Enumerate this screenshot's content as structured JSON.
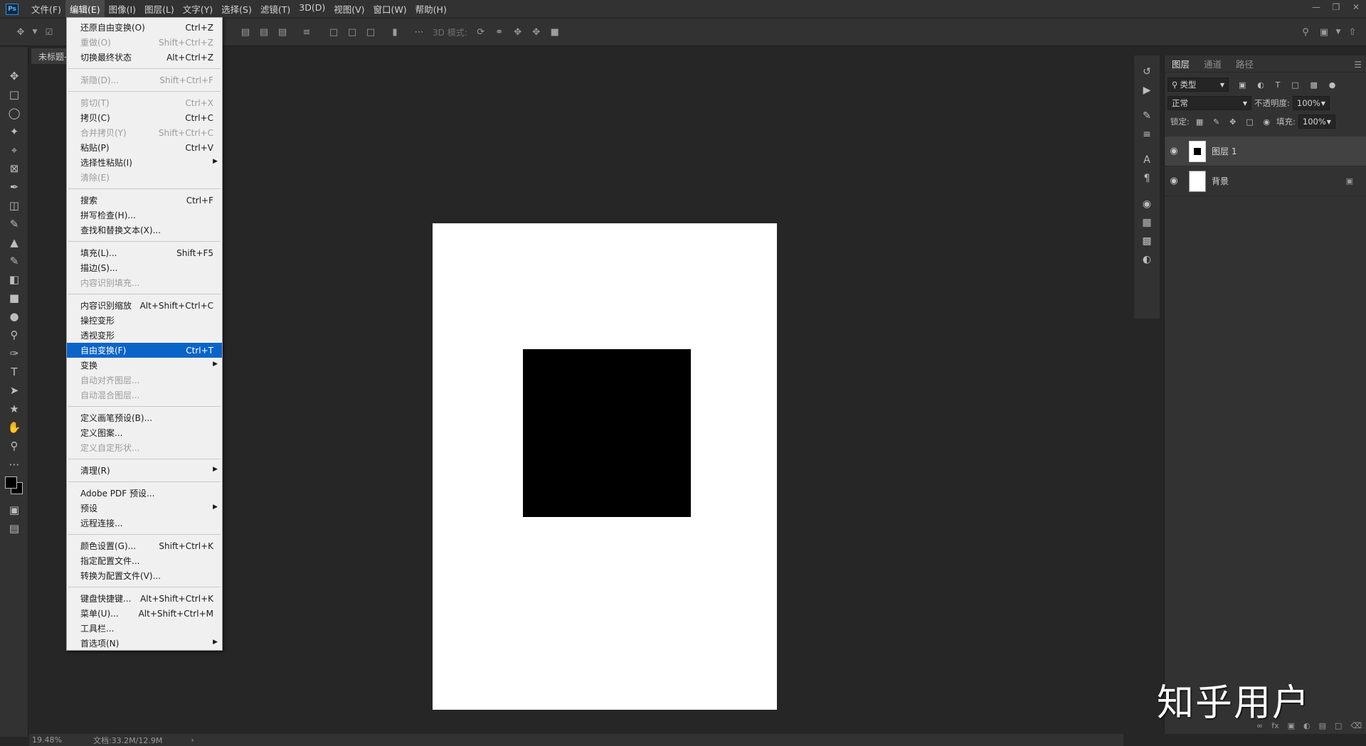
{
  "app": {
    "logo": "Ps"
  },
  "menubar": {
    "items": [
      "文件(F)",
      "编辑(E)",
      "图像(I)",
      "图层(L)",
      "文字(Y)",
      "选择(S)",
      "滤镜(T)",
      "3D(D)",
      "视图(V)",
      "窗口(W)",
      "帮助(H)"
    ],
    "active_index": 1
  },
  "options_bar": {
    "mode_label": "3D 模式:"
  },
  "document": {
    "tab_title": "未标题-"
  },
  "status": {
    "zoom": "19.48%",
    "doc_size": "文档:33.2M/12.9M"
  },
  "edit_menu": {
    "groups": [
      [
        {
          "label": "还原自由变换(O)",
          "shortcut": "Ctrl+Z",
          "disabled": false
        },
        {
          "label": "重做(O)",
          "shortcut": "Shift+Ctrl+Z",
          "disabled": true
        },
        {
          "label": "切换最终状态",
          "shortcut": "Alt+Ctrl+Z",
          "disabled": false
        }
      ],
      [
        {
          "label": "渐隐(D)...",
          "shortcut": "Shift+Ctrl+F",
          "disabled": true
        }
      ],
      [
        {
          "label": "剪切(T)",
          "shortcut": "Ctrl+X",
          "disabled": true
        },
        {
          "label": "拷贝(C)",
          "shortcut": "Ctrl+C",
          "disabled": false
        },
        {
          "label": "合并拷贝(Y)",
          "shortcut": "Shift+Ctrl+C",
          "disabled": true
        },
        {
          "label": "粘贴(P)",
          "shortcut": "Ctrl+V",
          "disabled": false
        },
        {
          "label": "选择性粘贴(I)",
          "shortcut": "",
          "disabled": false,
          "submenu": true
        },
        {
          "label": "清除(E)",
          "shortcut": "",
          "disabled": true
        }
      ],
      [
        {
          "label": "搜索",
          "shortcut": "Ctrl+F",
          "disabled": false
        },
        {
          "label": "拼写检查(H)...",
          "shortcut": "",
          "disabled": false
        },
        {
          "label": "查找和替换文本(X)...",
          "shortcut": "",
          "disabled": false
        }
      ],
      [
        {
          "label": "填充(L)...",
          "shortcut": "Shift+F5",
          "disabled": false
        },
        {
          "label": "描边(S)...",
          "shortcut": "",
          "disabled": false
        },
        {
          "label": "内容识别填充...",
          "shortcut": "",
          "disabled": true
        }
      ],
      [
        {
          "label": "内容识别缩放",
          "shortcut": "Alt+Shift+Ctrl+C",
          "disabled": false
        },
        {
          "label": "操控变形",
          "shortcut": "",
          "disabled": false
        },
        {
          "label": "透视变形",
          "shortcut": "",
          "disabled": false
        },
        {
          "label": "自由变换(F)",
          "shortcut": "Ctrl+T",
          "disabled": false,
          "highlight": true
        },
        {
          "label": "变换",
          "shortcut": "",
          "disabled": false,
          "submenu": true
        },
        {
          "label": "自动对齐图层...",
          "shortcut": "",
          "disabled": true
        },
        {
          "label": "自动混合图层...",
          "shortcut": "",
          "disabled": true
        }
      ],
      [
        {
          "label": "定义画笔预设(B)...",
          "shortcut": "",
          "disabled": false
        },
        {
          "label": "定义图案...",
          "shortcut": "",
          "disabled": false
        },
        {
          "label": "定义自定形状...",
          "shortcut": "",
          "disabled": true
        }
      ],
      [
        {
          "label": "清理(R)",
          "shortcut": "",
          "disabled": false,
          "submenu": true
        }
      ],
      [
        {
          "label": "Adobe PDF 预设...",
          "shortcut": "",
          "disabled": false
        },
        {
          "label": "预设",
          "shortcut": "",
          "disabled": false,
          "submenu": true
        },
        {
          "label": "远程连接...",
          "shortcut": "",
          "disabled": false
        }
      ],
      [
        {
          "label": "颜色设置(G)...",
          "shortcut": "Shift+Ctrl+K",
          "disabled": false
        },
        {
          "label": "指定配置文件...",
          "shortcut": "",
          "disabled": false
        },
        {
          "label": "转换为配置文件(V)...",
          "shortcut": "",
          "disabled": false
        }
      ],
      [
        {
          "label": "键盘快捷键...",
          "shortcut": "Alt+Shift+Ctrl+K",
          "disabled": false
        },
        {
          "label": "菜单(U)...",
          "shortcut": "Alt+Shift+Ctrl+M",
          "disabled": false
        },
        {
          "label": "工具栏...",
          "shortcut": "",
          "disabled": false
        },
        {
          "label": "首选项(N)",
          "shortcut": "",
          "disabled": false,
          "submenu": true
        }
      ]
    ]
  },
  "layers_panel": {
    "tabs": [
      "图层",
      "通道",
      "路径"
    ],
    "active_tab": 0,
    "filter_kind": "类型",
    "blend_mode": "正常",
    "opacity_label": "不透明度:",
    "opacity_value": "100%",
    "lock_label": "锁定:",
    "fill_label": "填充:",
    "fill_value": "100%",
    "layers": [
      {
        "name": "图层 1",
        "selected": true,
        "locked": false
      },
      {
        "name": "背景",
        "selected": false,
        "locked": true
      }
    ]
  },
  "watermark": "知乎用户"
}
